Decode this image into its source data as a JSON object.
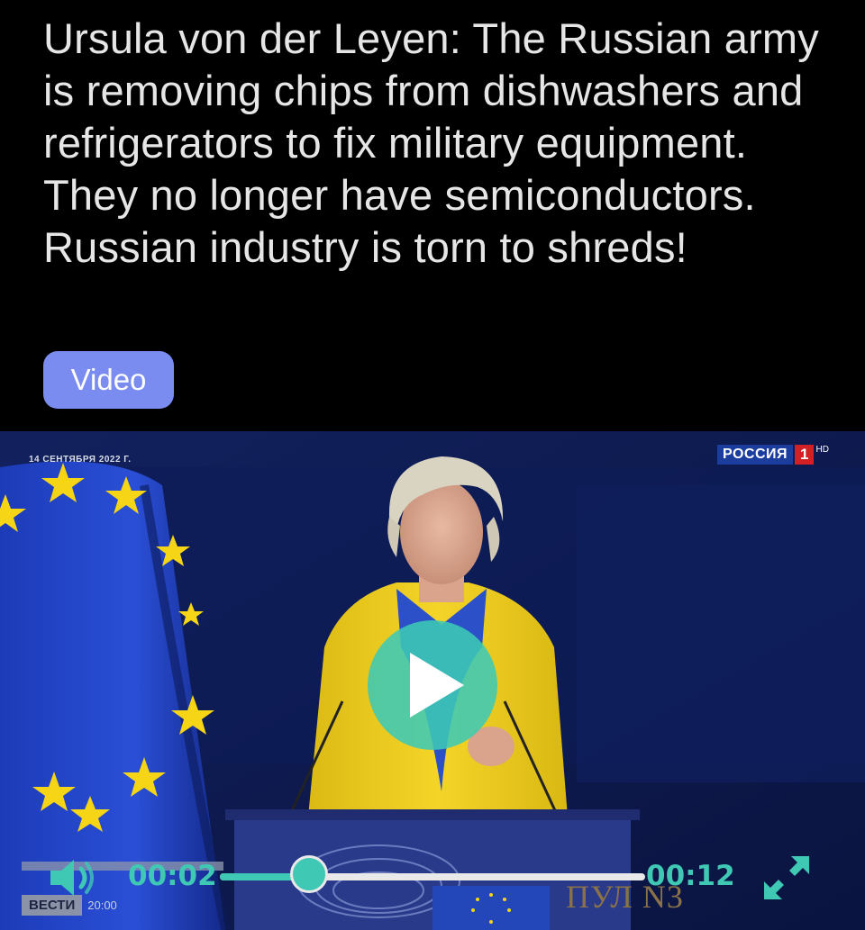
{
  "post": {
    "headline": "Ursula von der Leyen: The Russian army is removing chips from dishwashers and refrigerators to fix military equipment. They no longer have semiconductors. Russian industry is torn to shreds!",
    "badge": "Video"
  },
  "video": {
    "date_overlay": "14 СЕНТЯБРЯ 2022 Г.",
    "channel_name": "РОССИЯ",
    "channel_number": "1",
    "channel_hd": "HD",
    "news_logo": "ВЕСТИ",
    "news_time": "20:00",
    "podium_text": "ПУЛ N3"
  },
  "player": {
    "current_time": "00:02",
    "total_time": "00:12",
    "progress": 0.21,
    "accent_color": "#3fc8b3",
    "icons": {
      "play": "play-icon",
      "volume": "volume-icon",
      "fullscreen": "fullscreen-icon"
    }
  }
}
